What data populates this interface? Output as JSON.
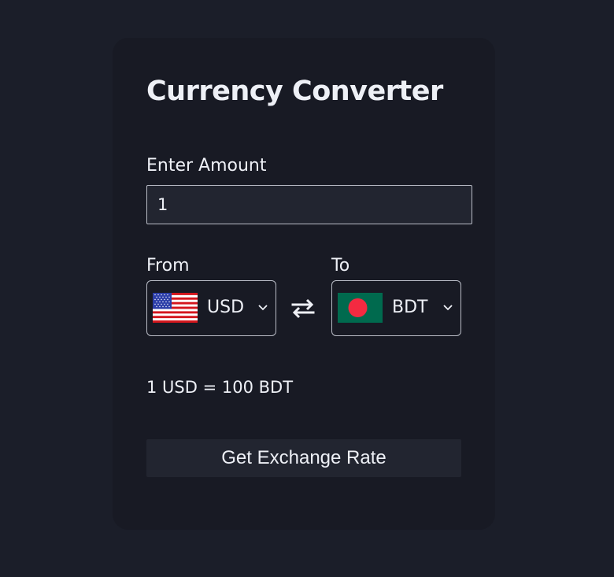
{
  "converter": {
    "title": "Currency Converter",
    "amount_label": "Enter Amount",
    "amount_value": "1",
    "from_label": "From",
    "to_label": "To",
    "from_currency": "USD",
    "to_currency": "BDT",
    "from_flag": "us-flag-icon",
    "to_flag": "bd-flag-icon",
    "swap_icon": "swap-arrows-icon",
    "rate_text": "1 USD = 100 BDT",
    "button_label": "Get Exchange Rate"
  },
  "colors": {
    "page_bg": "#1b1e29",
    "card_bg": "#181a24",
    "input_bg": "#222530",
    "border": "#b9bcc6",
    "text": "#eef0f6"
  }
}
